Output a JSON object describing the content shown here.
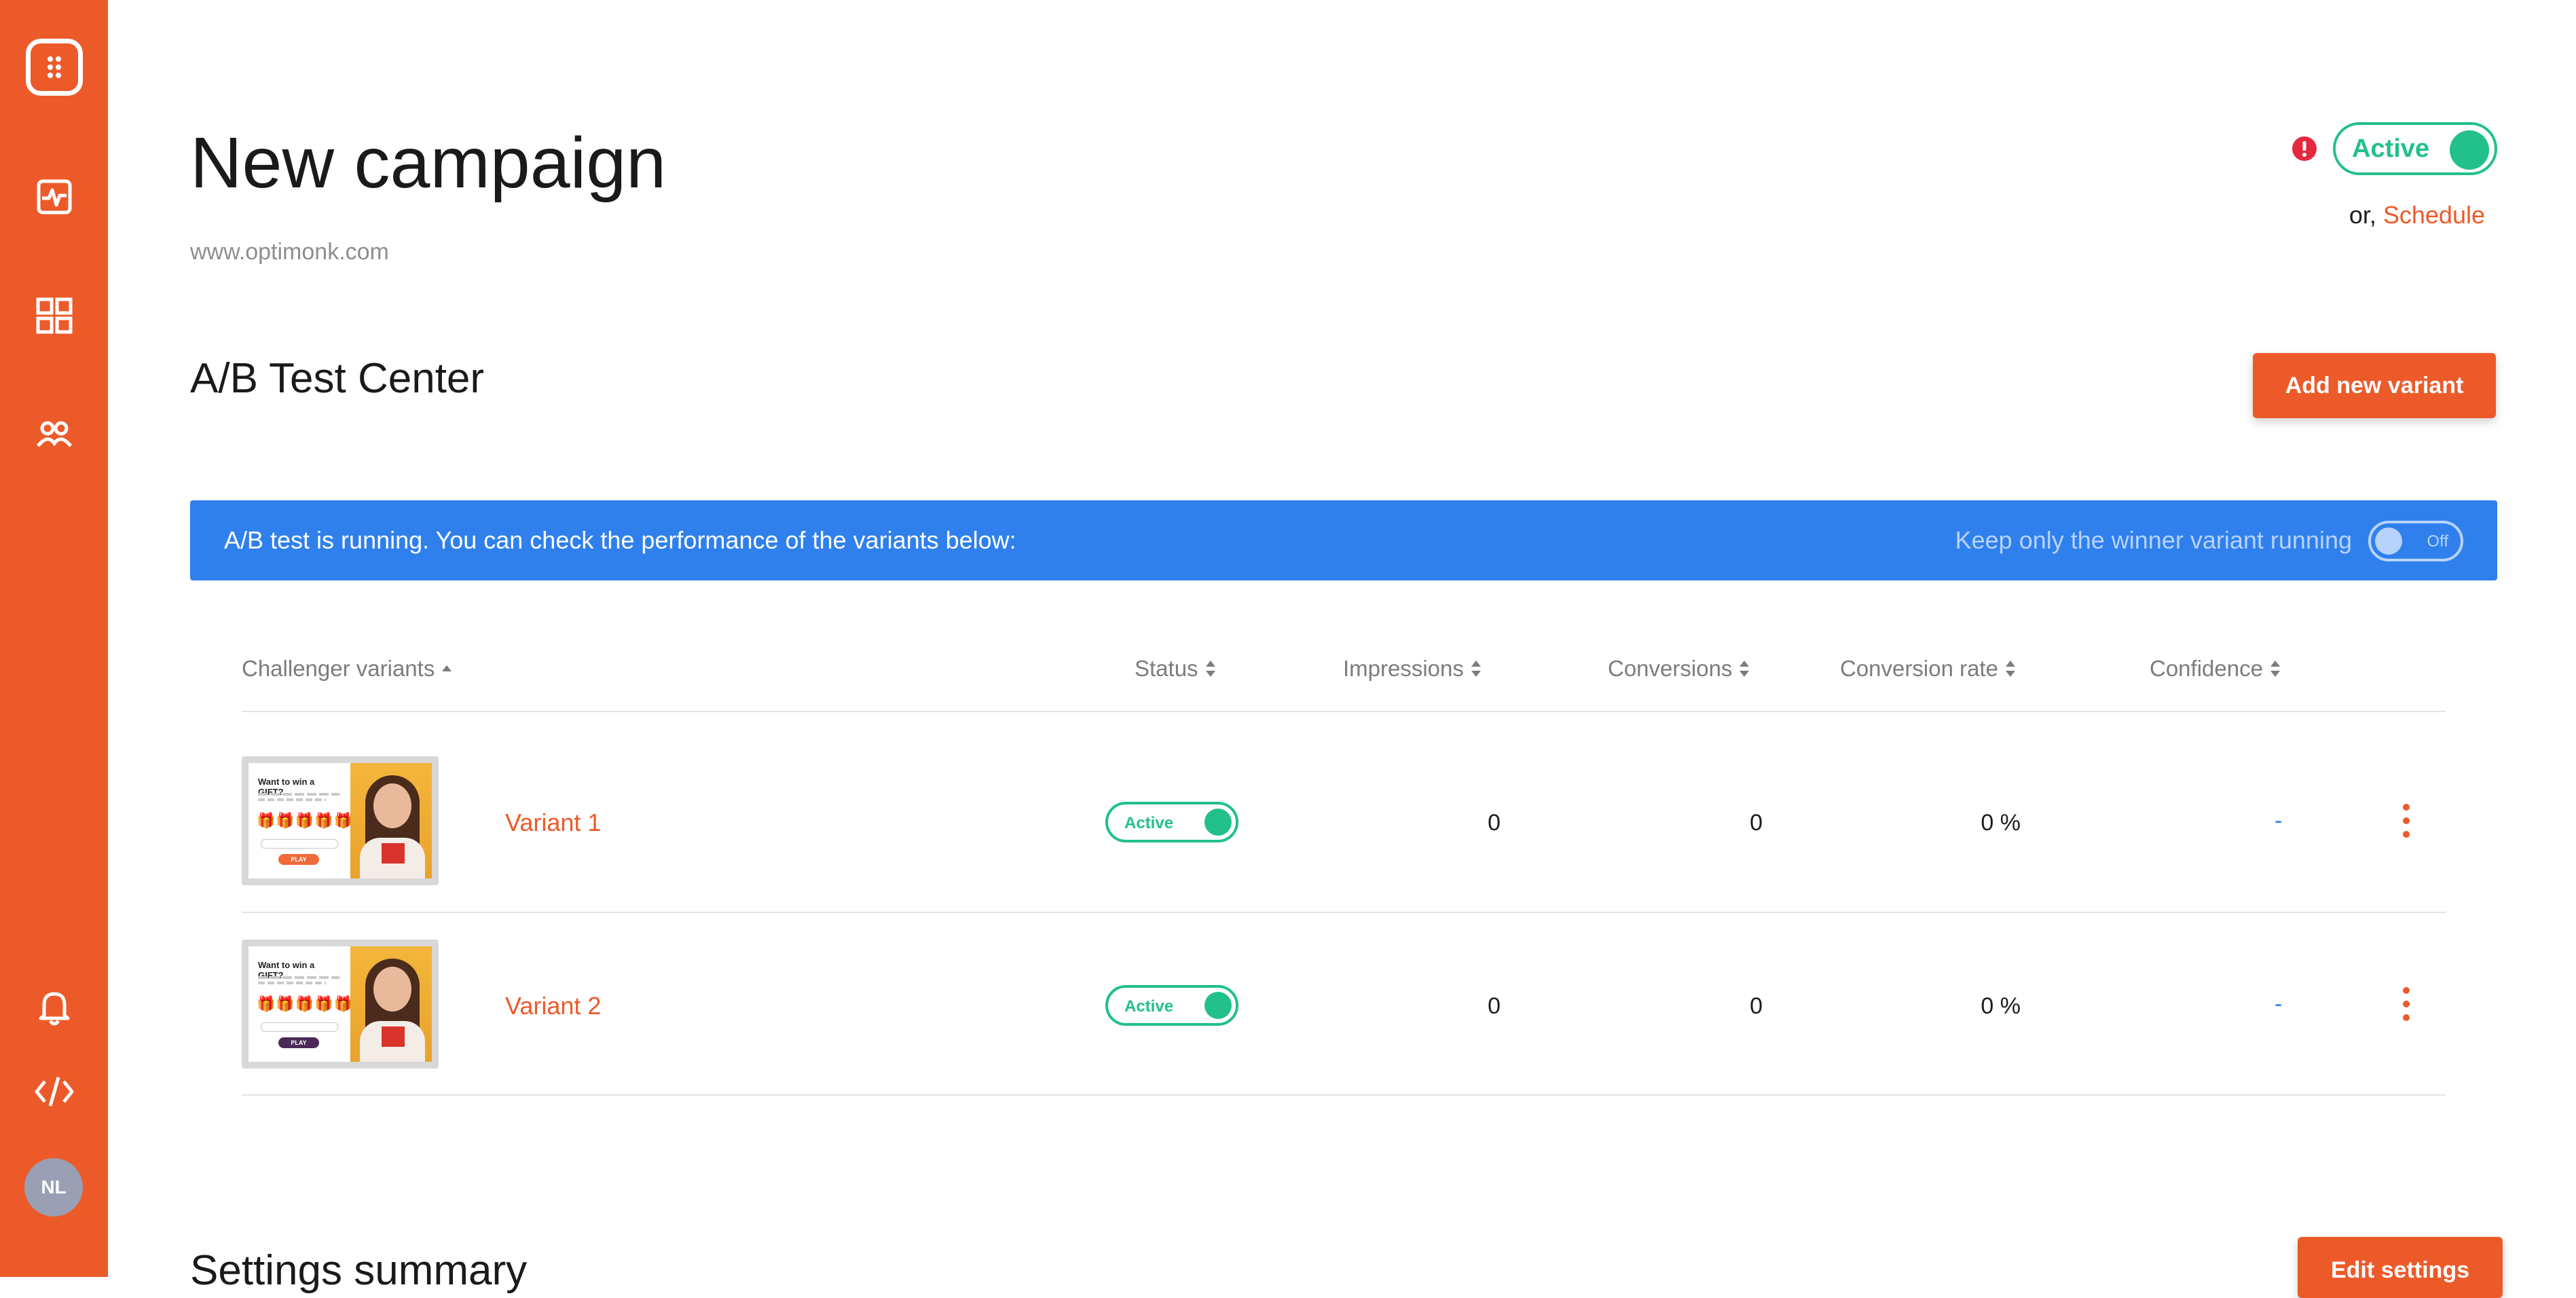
{
  "sidebar": {
    "logo_icon": "optimonk-logo-icon",
    "items": [
      {
        "name": "analytics",
        "icon": "activity-chart-icon"
      },
      {
        "name": "campaigns",
        "icon": "grid-icon"
      },
      {
        "name": "subscribers",
        "icon": "users-icon"
      }
    ],
    "bottom_items": [
      {
        "name": "notifications",
        "icon": "bell-icon"
      },
      {
        "name": "embed-code",
        "icon": "code-icon"
      }
    ],
    "avatar_initials": "NL"
  },
  "header": {
    "title": "New campaign",
    "domain": "www.optimonk.com",
    "status_label": "Active",
    "schedule_prefix": "or,",
    "schedule_link": "Schedule"
  },
  "ab_test": {
    "title": "A/B Test Center",
    "add_variant_label": "Add new variant",
    "banner_message": "A/B test is running. You can check the performance of the variants below:",
    "winner_label": "Keep only the winner variant running",
    "winner_toggle_text": "Off",
    "columns": {
      "variant": "Challenger variants",
      "status": "Status",
      "impressions": "Impressions",
      "conversions": "Conversions",
      "conversion_rate": "Conversion rate",
      "confidence": "Confidence"
    },
    "variants": [
      {
        "name": "Variant 1",
        "status": "Active",
        "impressions": "0",
        "conversions": "0",
        "conversion_rate": "0 %",
        "confidence": "-",
        "thumb_headline": "Want to win a GIFT?",
        "thumb_cta": "PLAY",
        "thumb_cta_color": "#f06b3a"
      },
      {
        "name": "Variant 2",
        "status": "Active",
        "impressions": "0",
        "conversions": "0",
        "conversion_rate": "0 %",
        "confidence": "-",
        "thumb_headline": "Want to win a GIFT?",
        "thumb_cta": "PLAY",
        "thumb_cta_color": "#4b2a57"
      }
    ]
  },
  "settings": {
    "title": "Settings summary",
    "edit_label": "Edit settings"
  },
  "colors": {
    "brand": "#ed5a29",
    "active_green": "#22c08a",
    "banner_blue": "#2f80ec",
    "warning_red": "#e5283d"
  }
}
